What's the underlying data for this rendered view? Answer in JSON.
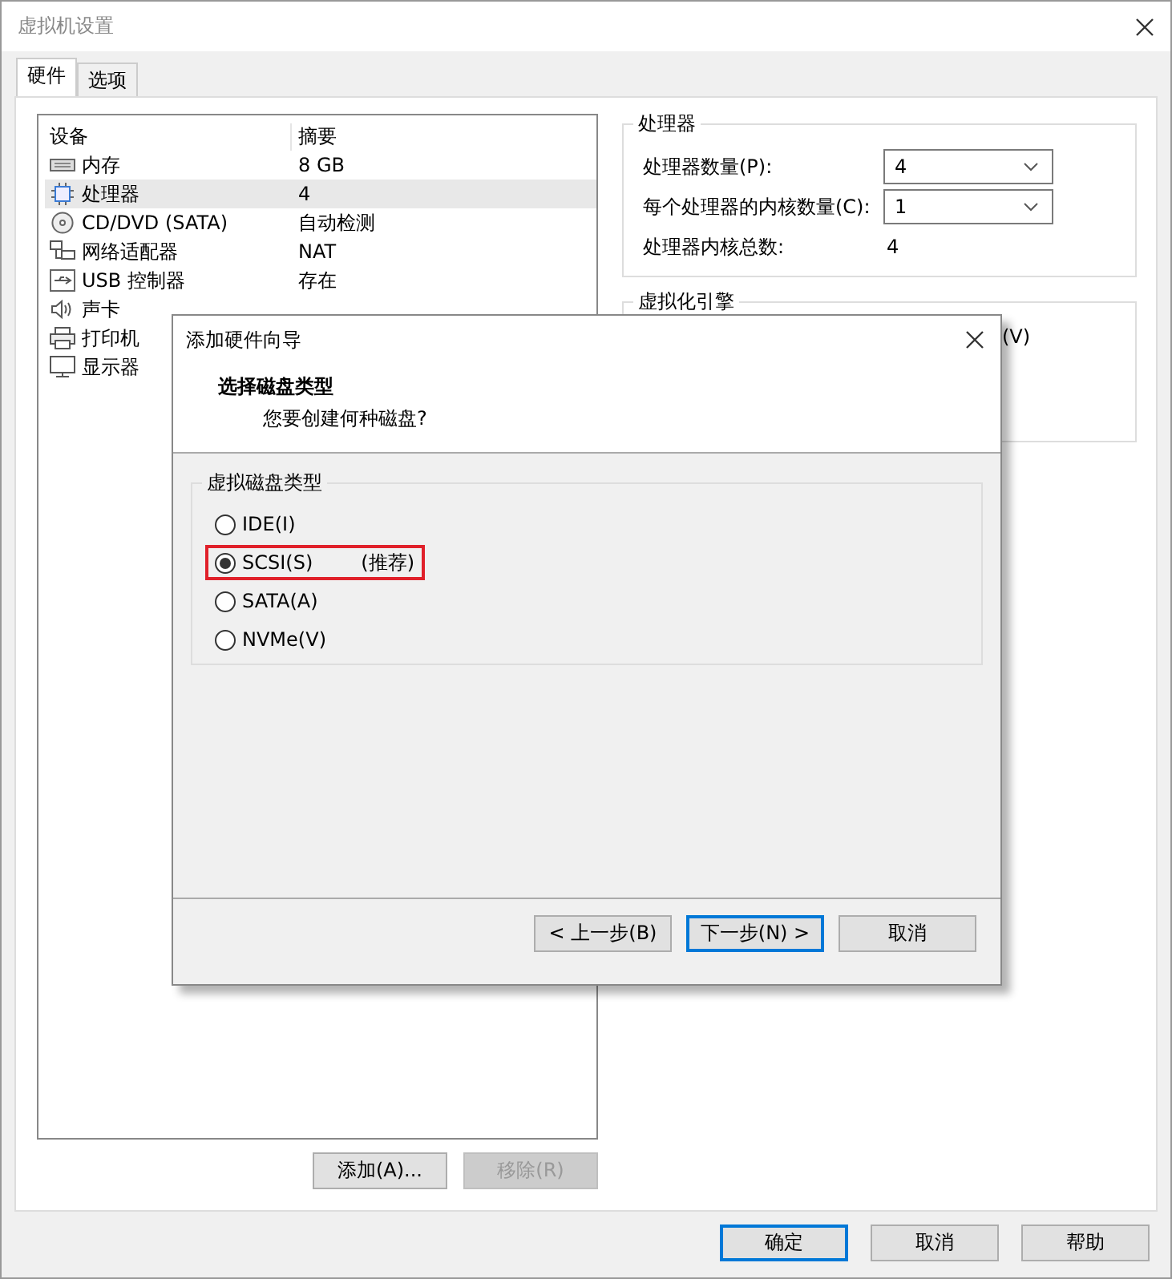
{
  "window": {
    "title": "虚拟机设置"
  },
  "tabs": [
    {
      "label": "硬件",
      "selected": true
    },
    {
      "label": "选项",
      "selected": false
    }
  ],
  "device_list": {
    "columns": [
      "设备",
      "摘要"
    ],
    "rows": [
      {
        "kind": "memory",
        "device": "内存",
        "summary": "8 GB",
        "selected": false
      },
      {
        "kind": "cpu",
        "device": "处理器",
        "summary": "4",
        "selected": true
      },
      {
        "kind": "cd",
        "device": "CD/DVD (SATA)",
        "summary": "自动检测",
        "selected": false
      },
      {
        "kind": "network",
        "device": "网络适配器",
        "summary": "NAT",
        "selected": false
      },
      {
        "kind": "usb",
        "device": "USB 控制器",
        "summary": "存在",
        "selected": false
      },
      {
        "kind": "sound",
        "device": "声卡",
        "selected": false
      },
      {
        "kind": "printer",
        "device": "打印机",
        "selected": false
      },
      {
        "kind": "display",
        "device": "显示器",
        "selected": false
      }
    ]
  },
  "list_buttons": [
    {
      "label": "添加(A)...",
      "disabled": false
    },
    {
      "label": "移除(R)",
      "disabled": true
    }
  ],
  "processor_group": {
    "title": "处理器",
    "fields": [
      {
        "label": "处理器数量(P):",
        "value": "4"
      },
      {
        "label": "每个处理器的内核数量(C):",
        "value": "1"
      }
    ],
    "total_label": "处理器内核总数:",
    "total_value": "4"
  },
  "virtualization_group": {
    "title": "虚拟化引擎",
    "option_fragment": "(V)"
  },
  "dialog_buttons": [
    {
      "label": "确定",
      "default": true
    },
    {
      "label": "取消",
      "default": false
    },
    {
      "label": "帮助",
      "default": false
    }
  ],
  "wizard": {
    "title": "添加硬件向导",
    "heading": "选择磁盘类型",
    "subheading": "您要创建何种磁盘?",
    "group_title": "虚拟磁盘类型",
    "options": [
      {
        "label": "IDE(I)",
        "selected": false,
        "highlighted": false
      },
      {
        "label": "SCSI(S)",
        "note": "(推荐)",
        "selected": true,
        "highlighted": true
      },
      {
        "label": "SATA(A)",
        "selected": false,
        "highlighted": false
      },
      {
        "label": "NVMe(V)",
        "selected": false,
        "highlighted": false
      }
    ],
    "buttons": [
      {
        "label": "< 上一步(B)",
        "default": false
      },
      {
        "label": "下一步(N) >",
        "default": true
      },
      {
        "label": "取消",
        "default": false
      }
    ]
  }
}
